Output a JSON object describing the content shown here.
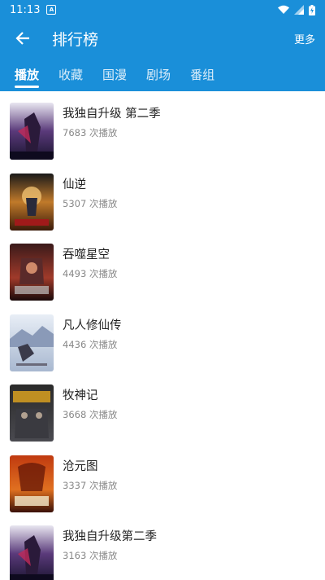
{
  "status": {
    "time": "11:13",
    "app_badge": "A"
  },
  "toolbar": {
    "title": "排行榜",
    "more_label": "更多"
  },
  "tabs": [
    {
      "label": "播放",
      "active": true
    },
    {
      "label": "收藏",
      "active": false
    },
    {
      "label": "国漫",
      "active": false
    },
    {
      "label": "剧场",
      "active": false
    },
    {
      "label": "番组",
      "active": false
    }
  ],
  "items": [
    {
      "title": "我独自升级 第二季",
      "plays": "7683 次播放"
    },
    {
      "title": "仙逆",
      "plays": "5307 次播放"
    },
    {
      "title": "吞噬星空",
      "plays": "4493 次播放"
    },
    {
      "title": "凡人修仙传",
      "plays": "4436 次播放"
    },
    {
      "title": "牧神记",
      "plays": "3668 次播放"
    },
    {
      "title": "沧元图",
      "plays": "3337 次播放"
    },
    {
      "title": "我独自升级第二季",
      "plays": "3163 次播放"
    }
  ],
  "colors": {
    "accent": "#1a8fd9"
  }
}
